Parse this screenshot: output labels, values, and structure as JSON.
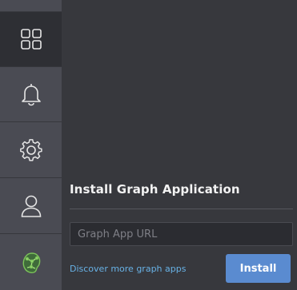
{
  "sidebar": {
    "items": [
      {
        "icon": "grid-icon",
        "active": true
      },
      {
        "icon": "bell-icon",
        "active": false
      },
      {
        "icon": "gear-icon",
        "active": false
      },
      {
        "icon": "user-icon",
        "active": false
      },
      {
        "icon": "graph-app-logo-icon",
        "active": false
      }
    ]
  },
  "main": {
    "title": "Install Graph Application",
    "url_input": {
      "value": "",
      "placeholder": "Graph App URL"
    },
    "discover_link": "Discover more graph apps",
    "install_label": "Install"
  },
  "colors": {
    "sidebar_bg": "#4a4b53",
    "active_item_bg": "#2e2f34",
    "main_bg": "#37383d",
    "accent_button": "#5a8bd0",
    "link": "#68b2e6"
  }
}
